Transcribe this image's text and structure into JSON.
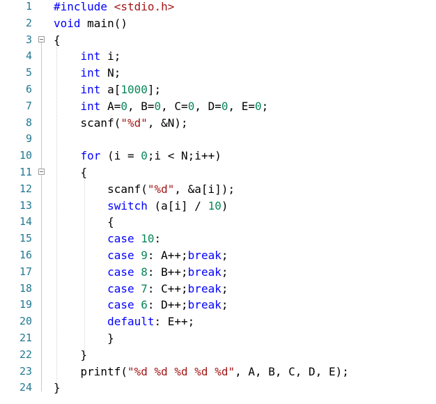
{
  "editor": {
    "lines": [
      {
        "number": "1",
        "tokens": [
          {
            "t": "#include ",
            "c": "pp"
          },
          {
            "t": "<stdio.h>",
            "c": "inc"
          }
        ]
      },
      {
        "number": "2",
        "tokens": [
          {
            "t": "void",
            "c": "kw"
          },
          {
            "t": " main()",
            "c": ""
          }
        ]
      },
      {
        "number": "3",
        "fold": true,
        "tokens": [
          {
            "t": "{",
            "c": ""
          }
        ]
      },
      {
        "number": "4",
        "tokens": [
          {
            "t": "    ",
            "c": ""
          },
          {
            "t": "int",
            "c": "kw"
          },
          {
            "t": " i;",
            "c": ""
          }
        ]
      },
      {
        "number": "5",
        "tokens": [
          {
            "t": "    ",
            "c": ""
          },
          {
            "t": "int",
            "c": "kw"
          },
          {
            "t": " N;",
            "c": ""
          }
        ]
      },
      {
        "number": "6",
        "tokens": [
          {
            "t": "    ",
            "c": ""
          },
          {
            "t": "int",
            "c": "kw"
          },
          {
            "t": " a[",
            "c": ""
          },
          {
            "t": "1000",
            "c": "num"
          },
          {
            "t": "];",
            "c": ""
          }
        ]
      },
      {
        "number": "7",
        "tokens": [
          {
            "t": "    ",
            "c": ""
          },
          {
            "t": "int",
            "c": "kw"
          },
          {
            "t": " A=",
            "c": ""
          },
          {
            "t": "0",
            "c": "num"
          },
          {
            "t": ", B=",
            "c": ""
          },
          {
            "t": "0",
            "c": "num"
          },
          {
            "t": ", C=",
            "c": ""
          },
          {
            "t": "0",
            "c": "num"
          },
          {
            "t": ", D=",
            "c": ""
          },
          {
            "t": "0",
            "c": "num"
          },
          {
            "t": ", E=",
            "c": ""
          },
          {
            "t": "0",
            "c": "num"
          },
          {
            "t": ";",
            "c": ""
          }
        ]
      },
      {
        "number": "8",
        "tokens": [
          {
            "t": "    scanf(",
            "c": ""
          },
          {
            "t": "\"%d\"",
            "c": "str"
          },
          {
            "t": ", &N);",
            "c": ""
          }
        ]
      },
      {
        "number": "9",
        "tokens": []
      },
      {
        "number": "10",
        "tokens": [
          {
            "t": "    ",
            "c": ""
          },
          {
            "t": "for",
            "c": "kw"
          },
          {
            "t": " (i = ",
            "c": ""
          },
          {
            "t": "0",
            "c": "num"
          },
          {
            "t": ";i < N;i++)",
            "c": ""
          }
        ]
      },
      {
        "number": "11",
        "fold": true,
        "tokens": [
          {
            "t": "    {",
            "c": ""
          }
        ]
      },
      {
        "number": "12",
        "tokens": [
          {
            "t": "        scanf(",
            "c": ""
          },
          {
            "t": "\"%d\"",
            "c": "str"
          },
          {
            "t": ", &a[i]);",
            "c": ""
          }
        ]
      },
      {
        "number": "13",
        "tokens": [
          {
            "t": "        ",
            "c": ""
          },
          {
            "t": "switch",
            "c": "kw"
          },
          {
            "t": " (a[i] / ",
            "c": ""
          },
          {
            "t": "10",
            "c": "num"
          },
          {
            "t": ")",
            "c": ""
          }
        ]
      },
      {
        "number": "14",
        "tokens": [
          {
            "t": "        {",
            "c": ""
          }
        ]
      },
      {
        "number": "15",
        "tokens": [
          {
            "t": "        ",
            "c": ""
          },
          {
            "t": "case",
            "c": "kw"
          },
          {
            "t": " ",
            "c": ""
          },
          {
            "t": "10",
            "c": "num"
          },
          {
            "t": ":",
            "c": ""
          }
        ]
      },
      {
        "number": "16",
        "tokens": [
          {
            "t": "        ",
            "c": ""
          },
          {
            "t": "case",
            "c": "kw"
          },
          {
            "t": " ",
            "c": ""
          },
          {
            "t": "9",
            "c": "num"
          },
          {
            "t": ": A++;",
            "c": ""
          },
          {
            "t": "break",
            "c": "kw"
          },
          {
            "t": ";",
            "c": ""
          }
        ]
      },
      {
        "number": "17",
        "tokens": [
          {
            "t": "        ",
            "c": ""
          },
          {
            "t": "case",
            "c": "kw"
          },
          {
            "t": " ",
            "c": ""
          },
          {
            "t": "8",
            "c": "num"
          },
          {
            "t": ": B++;",
            "c": ""
          },
          {
            "t": "break",
            "c": "kw"
          },
          {
            "t": ";",
            "c": ""
          }
        ]
      },
      {
        "number": "18",
        "tokens": [
          {
            "t": "        ",
            "c": ""
          },
          {
            "t": "case",
            "c": "kw"
          },
          {
            "t": " ",
            "c": ""
          },
          {
            "t": "7",
            "c": "num"
          },
          {
            "t": ": C++;",
            "c": ""
          },
          {
            "t": "break",
            "c": "kw"
          },
          {
            "t": ";",
            "c": ""
          }
        ]
      },
      {
        "number": "19",
        "tokens": [
          {
            "t": "        ",
            "c": ""
          },
          {
            "t": "case",
            "c": "kw"
          },
          {
            "t": " ",
            "c": ""
          },
          {
            "t": "6",
            "c": "num"
          },
          {
            "t": ": D++;",
            "c": ""
          },
          {
            "t": "break",
            "c": "kw"
          },
          {
            "t": ";",
            "c": ""
          }
        ]
      },
      {
        "number": "20",
        "tokens": [
          {
            "t": "        ",
            "c": ""
          },
          {
            "t": "default",
            "c": "kw"
          },
          {
            "t": ": E++;",
            "c": ""
          }
        ]
      },
      {
        "number": "21",
        "tokens": [
          {
            "t": "        }",
            "c": ""
          }
        ]
      },
      {
        "number": "22",
        "tokens": [
          {
            "t": "    }",
            "c": ""
          }
        ]
      },
      {
        "number": "23",
        "tokens": [
          {
            "t": "    printf(",
            "c": ""
          },
          {
            "t": "\"%d %d %d %d %d\"",
            "c": "str"
          },
          {
            "t": ", A, B, C, D, E);",
            "c": ""
          }
        ]
      },
      {
        "number": "24",
        "tokens": [
          {
            "t": "}",
            "c": ""
          }
        ]
      }
    ]
  }
}
